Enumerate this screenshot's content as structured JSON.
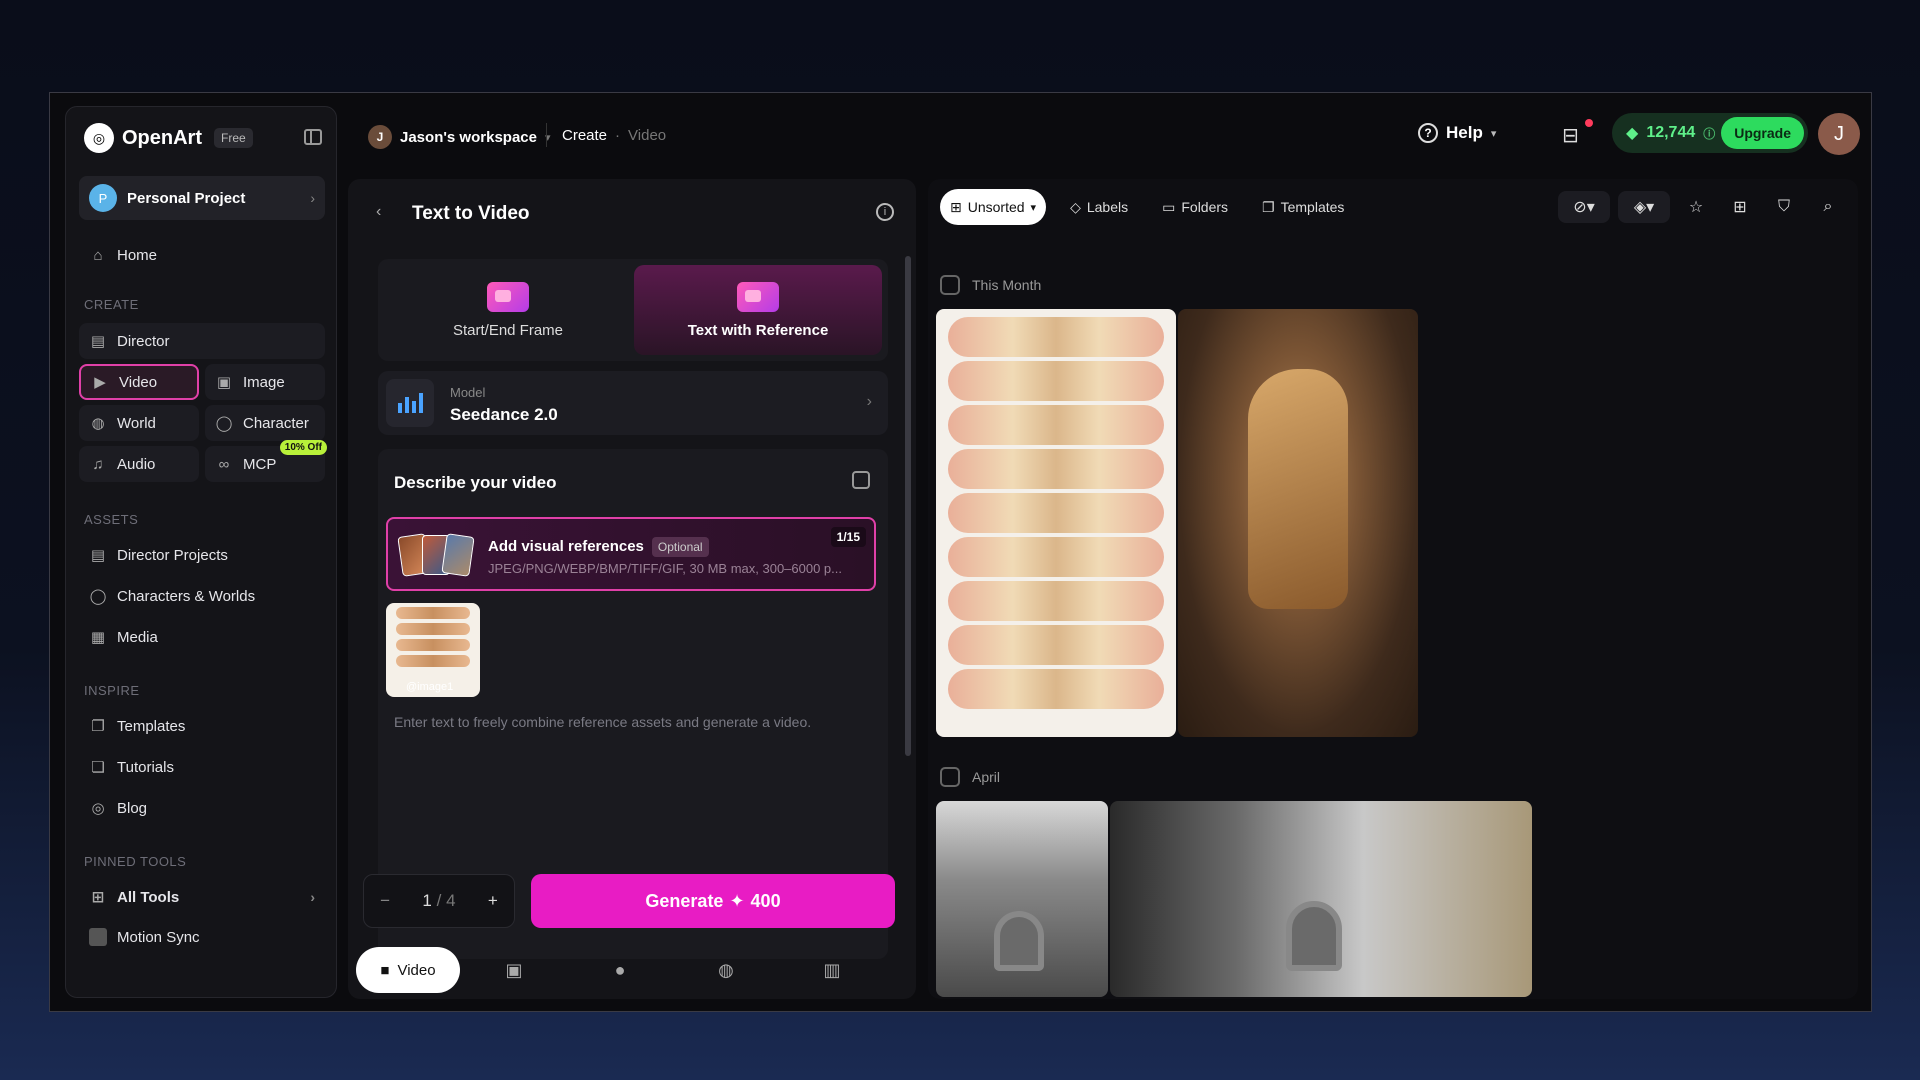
{
  "brand": {
    "name": "OpenArt",
    "plan": "Free"
  },
  "project": {
    "avatar": "P",
    "label": "Personal Project"
  },
  "sidebar": {
    "home": "Home",
    "create_label": "CREATE",
    "director": "Director",
    "video": "Video",
    "image": "Image",
    "world": "World",
    "character": "Character",
    "audio": "Audio",
    "mcp": "MCP",
    "mcp_badge": "10% Off",
    "assets_label": "ASSETS",
    "director_projects": "Director Projects",
    "characters_worlds": "Characters & Worlds",
    "media": "Media",
    "inspire_label": "INSPIRE",
    "templates": "Templates",
    "tutorials": "Tutorials",
    "blog": "Blog",
    "pinned_label": "PINNED TOOLS",
    "all_tools": "All Tools",
    "motion_sync": "Motion Sync"
  },
  "topbar": {
    "workspace_avatar": "J",
    "workspace": "Jason's workspace",
    "crumb_create": "Create",
    "crumb_sep": "·",
    "crumb_video": "Video",
    "help": "Help",
    "credits": "12,744",
    "upgrade": "Upgrade",
    "user_avatar": "J"
  },
  "panel": {
    "title": "Text to Video",
    "mode_start_end": "Start/End Frame",
    "mode_text_ref": "Text with Reference",
    "model_label": "Model",
    "model_value": "Seedance 2.0",
    "describe_title": "Describe your video",
    "ref_title": "Add visual references",
    "ref_optional": "Optional",
    "ref_sub": "JPEG/PNG/WEBP/BMP/TIFF/GIF, 30 MB max, 300–6000 p...",
    "ref_count": "1/15",
    "ref_image_tag": "@image1",
    "prompt_placeholder": "Enter text to freely combine reference assets and generate a video.",
    "count_current": "1",
    "count_total": "/ 4",
    "generate_label": "Generate",
    "generate_cost": "400",
    "tab_video": "Video"
  },
  "gallery": {
    "sort": "Unsorted",
    "labels": "Labels",
    "folders": "Folders",
    "templates": "Templates",
    "section_month": "This Month",
    "section_april": "April"
  }
}
